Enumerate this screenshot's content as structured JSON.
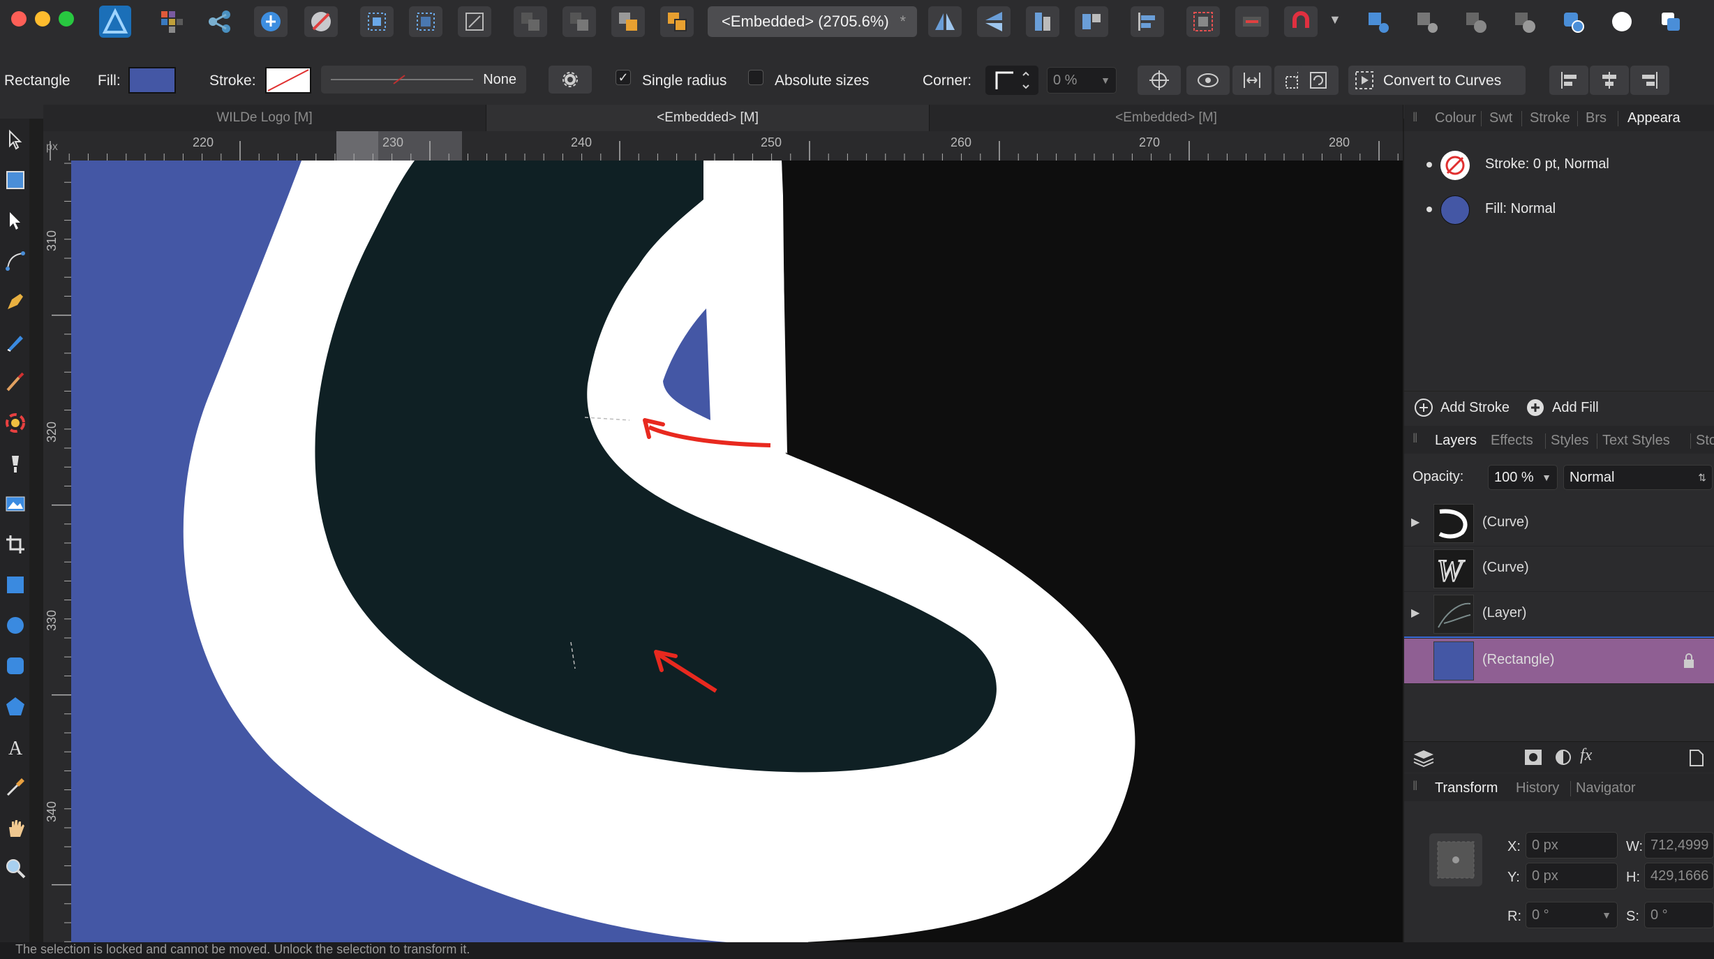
{
  "toolbar": {
    "document_title": "<Embedded> (2705.6%)",
    "modified_mark": "*"
  },
  "context": {
    "tool_name": "Rectangle",
    "fill_label": "Fill:",
    "fill_color": "#4457a5",
    "stroke_label": "Stroke:",
    "stroke_style_value": "None",
    "single_radius_label": "Single radius",
    "single_radius_checked": true,
    "absolute_sizes_label": "Absolute sizes",
    "absolute_sizes_checked": false,
    "corner_label": "Corner:",
    "corner_value": "0 %",
    "convert_label": "Convert to Curves"
  },
  "doc_tabs": [
    "WILDe Logo [M]",
    "<Embedded> [M]",
    "<Embedded> [M]"
  ],
  "ruler": {
    "unit": "px",
    "top_ticks": [
      "220",
      "230",
      "240",
      "250",
      "260",
      "270",
      "280"
    ],
    "left_ticks": [
      "310",
      "320",
      "330",
      "340"
    ]
  },
  "appearance": {
    "tabs": [
      "Colour",
      "Swt",
      "Stroke",
      "Brs",
      "Appeara"
    ],
    "stroke_entry": "Stroke: 0 pt, Normal",
    "fill_entry": "Fill: Normal",
    "add_stroke": "Add Stroke",
    "add_fill": "Add Fill"
  },
  "layers": {
    "tabs": [
      "Layers",
      "Effects",
      "Styles",
      "Text Styles",
      "Stoc"
    ],
    "opacity_label": "Opacity:",
    "opacity_value": "100 %",
    "blend_mode": "Normal",
    "rows": [
      {
        "name": "(Curve)"
      },
      {
        "name": "(Curve)"
      },
      {
        "name": "(Layer)"
      },
      {
        "name": "(Rectangle)"
      }
    ]
  },
  "transform": {
    "tabs": [
      "Transform",
      "History",
      "Navigator"
    ],
    "x_label": "X:",
    "x_value": "0 px",
    "y_label": "Y:",
    "y_value": "0 px",
    "w_label": "W:",
    "w_value": "712,4999",
    "h_label": "H:",
    "h_value": "429,1666",
    "r_label": "R:",
    "r_value": "0 °",
    "s_label": "S:",
    "s_value": "0 °"
  },
  "status_text": "The selection is locked and cannot be moved. Unlock the selection to transform it."
}
